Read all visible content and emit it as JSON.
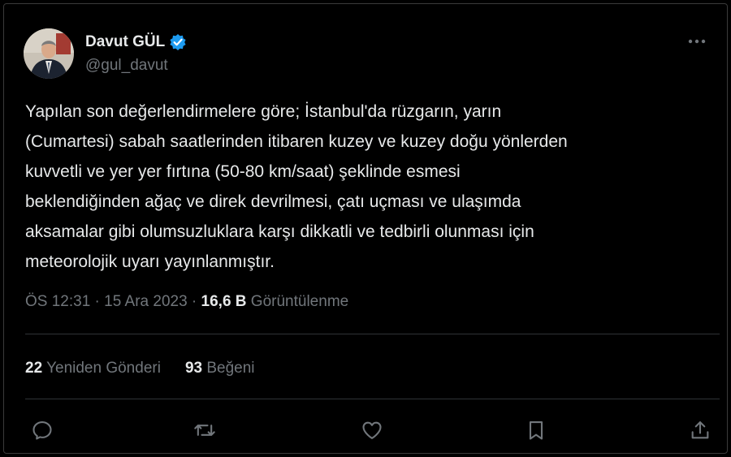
{
  "author": {
    "display_name": "Davut GÜL",
    "handle": "@gul_davut",
    "avatar_icon": "profile-photo",
    "verified_color": "#1d9bf0"
  },
  "tweet": {
    "text": "Yapılan son değerlendirmelere göre; İstanbul'da rüzgarın, yarın\n(Cumartesi) sabah saatlerinden itibaren kuzey ve kuzey doğu yönlerden\nkuvvetli ve yer yer fırtına (50-80 km/saat) şeklinde esmesi\nbeklendiğinden ağaç ve direk devrilmesi, çatı uçması ve ulaşımda\naksamalar gibi olumsuzluklara karşı dikkatli ve tedbirli olunması için\nmeteorolojik uyarı yayınlanmıştır."
  },
  "meta": {
    "time": "ÖS 12:31",
    "separator": " · ",
    "date": "15 Ara 2023",
    "views_count": "16,6 B",
    "views_label": " Görüntülenme"
  },
  "stats": {
    "reposts_count": "22",
    "reposts_label": " Yeniden Gönderi",
    "likes_count": "93",
    "likes_label": " Beğeni"
  },
  "actions": {
    "reply_icon": "reply-icon",
    "repost_icon": "repost-icon",
    "like_icon": "like-icon",
    "bookmark_icon": "bookmark-icon",
    "share_icon": "share-icon"
  },
  "colors": {
    "background": "#000000",
    "text": "#e7e9ea",
    "muted": "#71767b",
    "divider": "#2f3336",
    "accent": "#1d9bf0"
  }
}
